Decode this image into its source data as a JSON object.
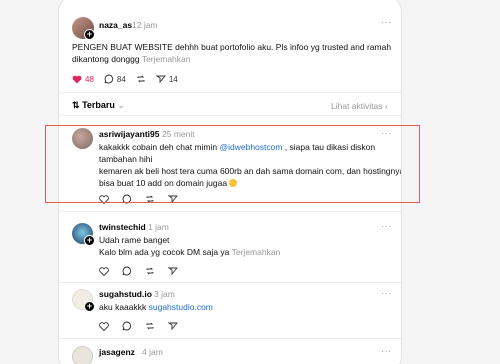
{
  "post": {
    "username": "naza_as",
    "time": "12 jam",
    "text": "PENGEN BUAT WEBSITE dehhh buat portofolio aku. Pls infoo yg trusted and ramah dikantong donggg",
    "translate": "Terjemahkan",
    "likes": "48",
    "replies": "84",
    "shares": "14"
  },
  "sort_bar": {
    "sort_label": "Terbaru",
    "view_activity": "Lihat aktivitas"
  },
  "comments": [
    {
      "username": "asriwijayanti95",
      "time": "25 menit",
      "line1_pre": "kakakkk cobain deh chat mimin ",
      "mention": "@idwebhostcom",
      "line1_post": " , siapa tau dikasi diskon",
      "line2": "tambahan hihi",
      "line3": "kemaren ak beli host tera cuma 600rb an dah sama domain com, dan hostingnya",
      "line4": "bisa buat 10 add on domain jugaa"
    },
    {
      "username": "twinstechid",
      "time": "1 jam",
      "line1": "Udah rame banget",
      "line2": "Kalo blm ada yg cocok DM saja ya",
      "translate": "Terjemahkan"
    },
    {
      "username": "sugahstud.io",
      "time": "3 jam",
      "text_pre": "aku kaaakkk ",
      "link": "sugahstudio.com"
    },
    {
      "username": "jasagenz",
      "time": "4 jam"
    }
  ],
  "icons": {
    "heart": "heart-icon",
    "reply": "comment-icon",
    "repost": "repost-icon",
    "share": "share-icon",
    "more": "more-icon",
    "sort": "sort-icon",
    "chevron": "chevron-right-icon"
  },
  "colors": {
    "link": "#1f6fd1",
    "heart": "#e0245e",
    "highlight": "#e25a5a"
  }
}
